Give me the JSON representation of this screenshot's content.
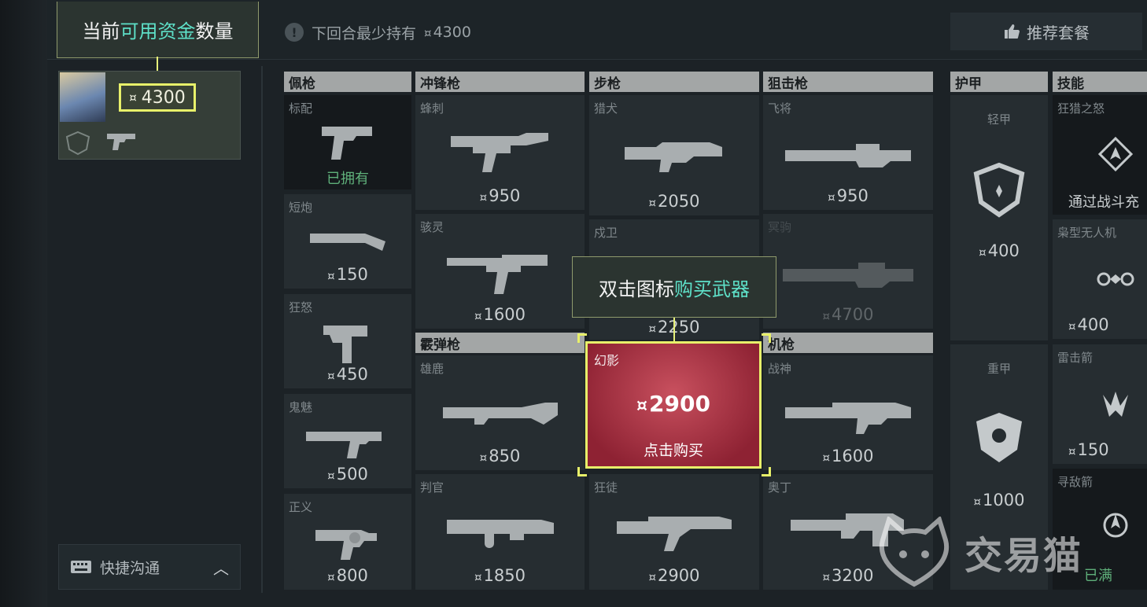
{
  "topbar": {
    "funds_tip_prefix": "当前",
    "funds_tip_highlight": "可用资金",
    "funds_tip_suffix": "数量",
    "warn_glyph": "!",
    "min_hold_label": "下回合最少持有",
    "min_hold_value": "4300",
    "recommend_label": "推荐套餐"
  },
  "currency_glyph": "¤",
  "player": {
    "credits": "4300"
  },
  "quick_comm_label": "快捷沟通",
  "categories": {
    "sidearm": "佩枪",
    "smg": "冲锋枪",
    "rifle": "步枪",
    "sniper": "狙击枪",
    "shotgun": "霰弹枪",
    "machinegun": "机枪",
    "armor": "护甲",
    "skills": "技能"
  },
  "sidearms": [
    {
      "name": "标配",
      "status": "已拥有"
    },
    {
      "name": "短炮",
      "price": "150"
    },
    {
      "name": "狂怒",
      "price": "450"
    },
    {
      "name": "鬼魅",
      "price": "500"
    },
    {
      "name": "正义",
      "price": "800"
    }
  ],
  "smgs": [
    {
      "name": "蜂刺",
      "price": "950"
    },
    {
      "name": "骇灵",
      "price": "1600"
    }
  ],
  "shotguns": [
    {
      "name": "雄鹿",
      "price": "850"
    },
    {
      "name": "判官",
      "price": "1850"
    }
  ],
  "rifles": [
    {
      "name": "猎犬",
      "price": "2050"
    },
    {
      "name": "戍卫",
      "price": "2250"
    },
    {
      "name": "幻影",
      "price": "2900",
      "action": "点击购买"
    },
    {
      "name": "狂徒",
      "price": "2900"
    }
  ],
  "snipers": [
    {
      "name": "飞将",
      "price": "950"
    },
    {
      "name": "冥驹",
      "price": "4700"
    }
  ],
  "machineguns": [
    {
      "name": "战神",
      "price": "1600"
    },
    {
      "name": "奥丁",
      "price": "3200"
    }
  ],
  "armor": [
    {
      "name": "轻甲",
      "price": "400"
    },
    {
      "name": "重甲",
      "price": "1000"
    }
  ],
  "skills": [
    {
      "name": "狂猎之怒",
      "note": "通过战斗充"
    },
    {
      "name": "枭型无人机",
      "price": "400"
    },
    {
      "name": "雷击箭",
      "price": "150"
    },
    {
      "name": "寻敌箭",
      "status": "已满"
    }
  ],
  "buy_tip": {
    "prefix": "双击图标",
    "highlight": "购买武器"
  },
  "watermark": "交易猫",
  "colors": {
    "accent_yellow": "#e8f06a",
    "highlight_teal": "#5ee0c8",
    "selected_red": "#b13a4b",
    "owned_green": "#5fb07a"
  }
}
